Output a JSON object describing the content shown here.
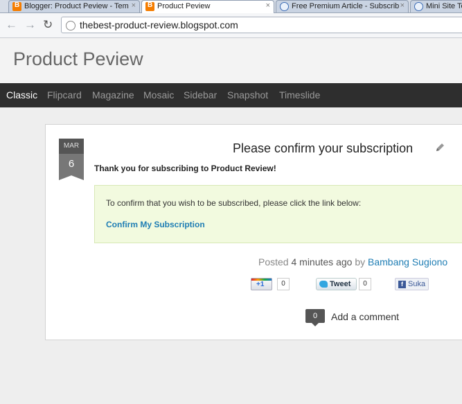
{
  "browser": {
    "tabs": [
      {
        "label": "Blogger: Product Peview - Tem",
        "icon": "blogger-icon"
      },
      {
        "label": "Product Peview",
        "icon": "blogger-icon"
      },
      {
        "label": "Free Premium Article - Subscrib",
        "icon": "globe-icon"
      },
      {
        "label": "Mini Site Te",
        "icon": "globe-icon"
      }
    ],
    "close_glyph": "×",
    "url": "thebest-product-review.blogspot.com",
    "back_glyph": "←",
    "forward_glyph": "→",
    "reload_glyph": "↻"
  },
  "blog": {
    "title": "Product Peview",
    "nav": [
      "Classic",
      "Flipcard",
      "Magazine",
      "Mosaic",
      "Sidebar",
      "Snapshot",
      "Timeslide"
    ]
  },
  "post": {
    "date_month": "MAR",
    "date_day": "6",
    "title": "Please confirm your subscription",
    "intro": "Thank you for subscribing to Product Review!",
    "notice_text": "To confirm that you wish to be subscribed, please click the link below:",
    "confirm_link": "Confirm My Subscription",
    "posted_label": "Posted",
    "time": "4 minutes ago",
    "by_label": "by",
    "author": "Bambang Sugiono"
  },
  "share": {
    "gplus_label": "+1",
    "gplus_count": "0",
    "tweet_label": "Tweet",
    "tweet_count": "0",
    "fb_label": "Suka"
  },
  "comments": {
    "count": "0",
    "add_label": "Add a comment"
  },
  "colors": {
    "nav_bg": "#2e2e2e",
    "link": "#1e7db4",
    "notice_bg": "#f2fadf"
  }
}
